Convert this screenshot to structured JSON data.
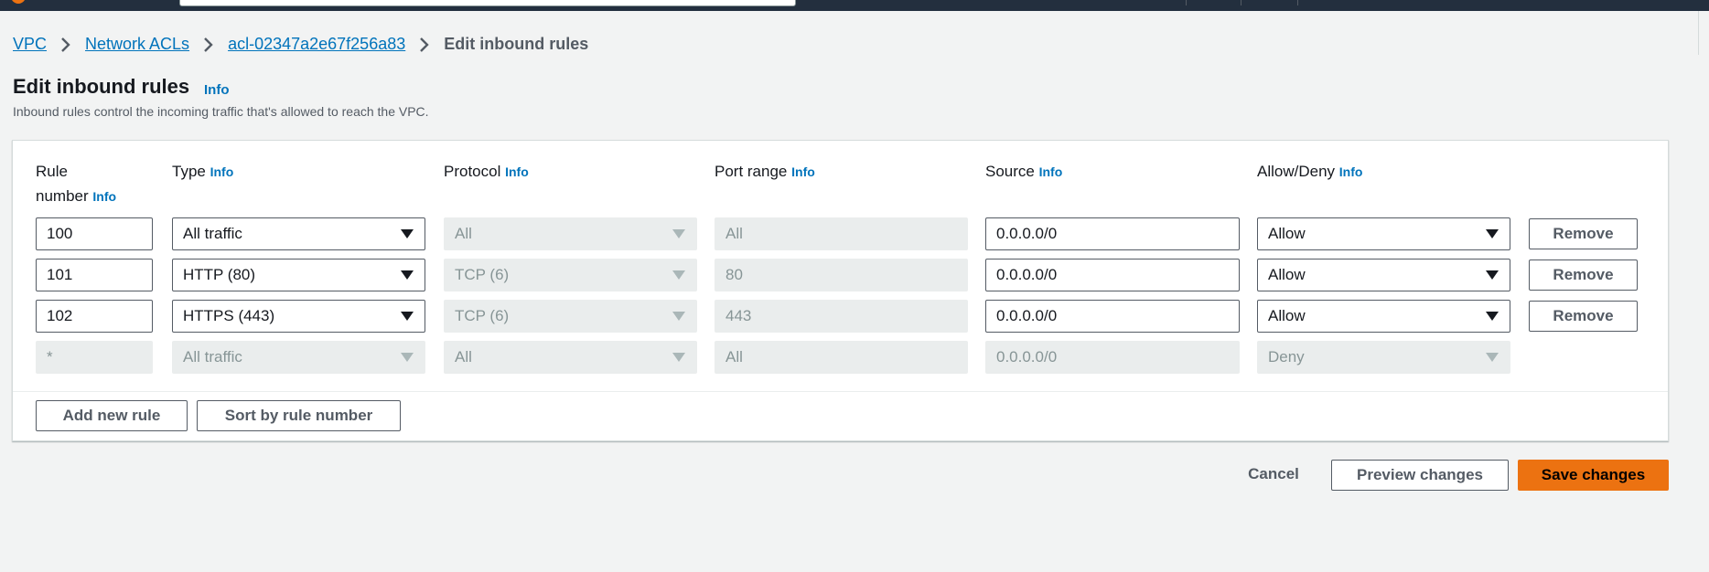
{
  "breadcrumb": {
    "items": [
      "VPC",
      "Network ACLs",
      "acl-02347a2e67f256a83"
    ],
    "current": "Edit inbound rules"
  },
  "header": {
    "title": "Edit inbound rules",
    "info": "Info",
    "description": "Inbound rules control the incoming traffic that's allowed to reach the VPC."
  },
  "table": {
    "columns": {
      "rule_line1": "Rule",
      "rule_line2": "number",
      "type": "Type",
      "protocol": "Protocol",
      "port_range": "Port range",
      "source": "Source",
      "allow_deny": "Allow/Deny",
      "info": "Info"
    },
    "rows": [
      {
        "rule": "100",
        "type": "All traffic",
        "protocol": "All",
        "port": "All",
        "source": "0.0.0.0/0",
        "action": "Allow",
        "remove": "Remove"
      },
      {
        "rule": "101",
        "type": "HTTP (80)",
        "protocol": "TCP (6)",
        "port": "80",
        "source": "0.0.0.0/0",
        "action": "Allow",
        "remove": "Remove"
      },
      {
        "rule": "102",
        "type": "HTTPS (443)",
        "protocol": "TCP (6)",
        "port": "443",
        "source": "0.0.0.0/0",
        "action": "Allow",
        "remove": "Remove"
      }
    ],
    "default_row": {
      "rule": "*",
      "type": "All traffic",
      "protocol": "All",
      "port": "All",
      "source": "0.0.0.0/0",
      "action": "Deny"
    },
    "add_rule": "Add new rule",
    "sort": "Sort by rule number"
  },
  "footer": {
    "cancel": "Cancel",
    "preview": "Preview changes",
    "save": "Save changes"
  },
  "colors": {
    "link": "#0073bb",
    "primary": "#ec7211",
    "nav": "#232f3e"
  }
}
